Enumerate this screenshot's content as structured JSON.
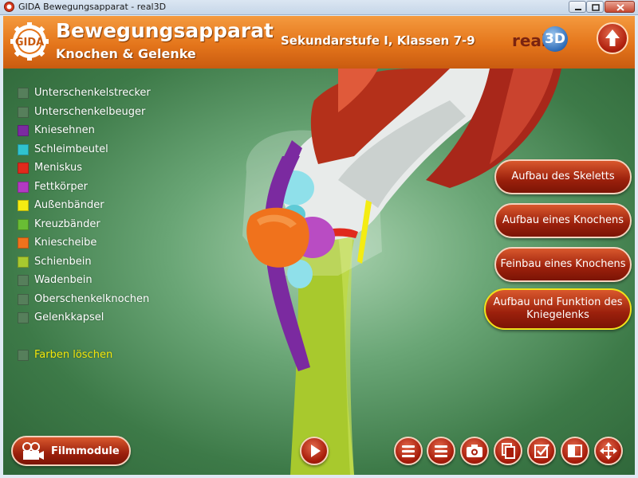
{
  "window": {
    "title": "GIDA  Bewegungsapparat - real3D"
  },
  "header": {
    "title": "Bewegungsapparat",
    "subtitle": "Knochen & Gelenke",
    "level": "Sekundarstufe I, Klassen 7-9",
    "brand_text": "real",
    "brand_ball_text": "3D",
    "logo_text": "GIDA"
  },
  "legend": {
    "items": [
      {
        "label": "Unterschenkelstrecker",
        "color": "#567f5b"
      },
      {
        "label": "Unterschenkelbeuger",
        "color": "#567f5b"
      },
      {
        "label": "Kniesehnen",
        "color": "#7b2aa0"
      },
      {
        "label": "Schleimbeutel",
        "color": "#2fc3cf"
      },
      {
        "label": "Meniskus",
        "color": "#e02a1c"
      },
      {
        "label": "Fettkörper",
        "color": "#b23ac2"
      },
      {
        "label": "Außenbänder",
        "color": "#f4ec12"
      },
      {
        "label": "Kreuzbänder",
        "color": "#69bd34"
      },
      {
        "label": "Kniescheibe",
        "color": "#f0721c"
      },
      {
        "label": "Schienbein",
        "color": "#a7c92f"
      },
      {
        "label": "Wadenbein",
        "color": "#567f5b"
      },
      {
        "label": "Oberschenkelknochen",
        "color": "#567f5b"
      },
      {
        "label": "Gelenkkapsel",
        "color": "#567f5b"
      }
    ],
    "clear_label": "Farben löschen",
    "clear_color": "#567f5b"
  },
  "nav": {
    "items": [
      {
        "label": "Aufbau des Skeletts",
        "active": false
      },
      {
        "label": "Aufbau eines Knochens",
        "active": false
      },
      {
        "label": "Feinbau eines Knochens",
        "active": false
      },
      {
        "label": "Aufbau und Funktion des Kniegelenks",
        "active": true
      }
    ]
  },
  "bottom": {
    "film_label": "Filmmodule"
  },
  "colors": {
    "accent_orange": "#e4751b",
    "button_red": "#9b200c",
    "active_outline": "#f1e21b",
    "stage_green": "#3d7a48"
  }
}
